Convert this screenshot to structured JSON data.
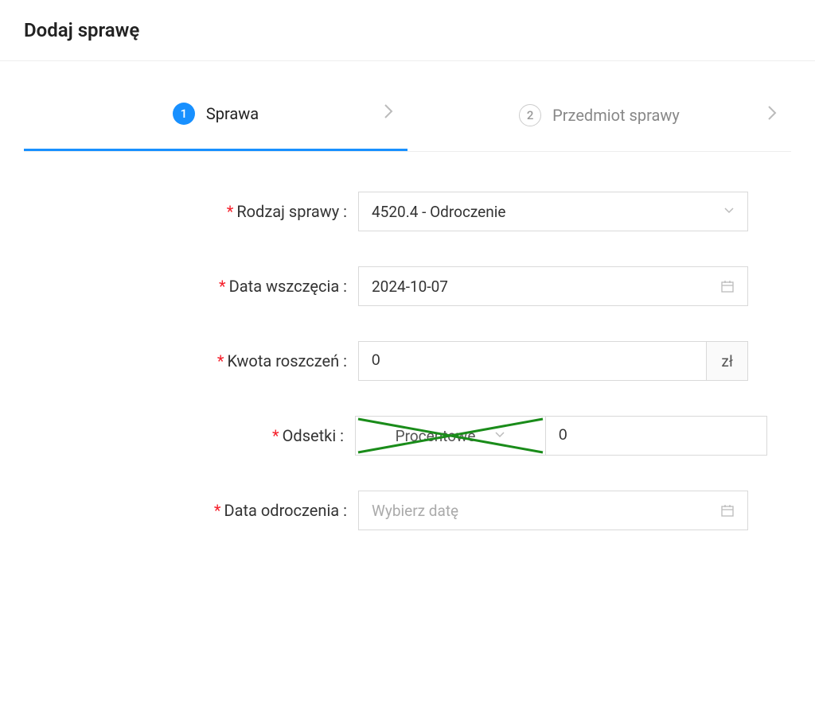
{
  "header": {
    "title": "Dodaj sprawę"
  },
  "steps": {
    "step1": {
      "number": "1",
      "label": "Sprawa"
    },
    "step2": {
      "number": "2",
      "label": "Przedmiot sprawy"
    }
  },
  "form": {
    "rodzaj_sprawy": {
      "label": "Rodzaj sprawy :",
      "value": "4520.4 - Odroczenie"
    },
    "data_wszczecia": {
      "label": "Data wszczęcia :",
      "value": "2024-10-07"
    },
    "kwota_roszczen": {
      "label": "Kwota roszczeń :",
      "value": "0",
      "suffix": "zł"
    },
    "odsetki": {
      "label": "Odsetki :",
      "type_value": "Procentowe",
      "amount_value": "0"
    },
    "data_odroczenia": {
      "label": "Data odroczenia :",
      "placeholder": "Wybierz datę"
    }
  }
}
